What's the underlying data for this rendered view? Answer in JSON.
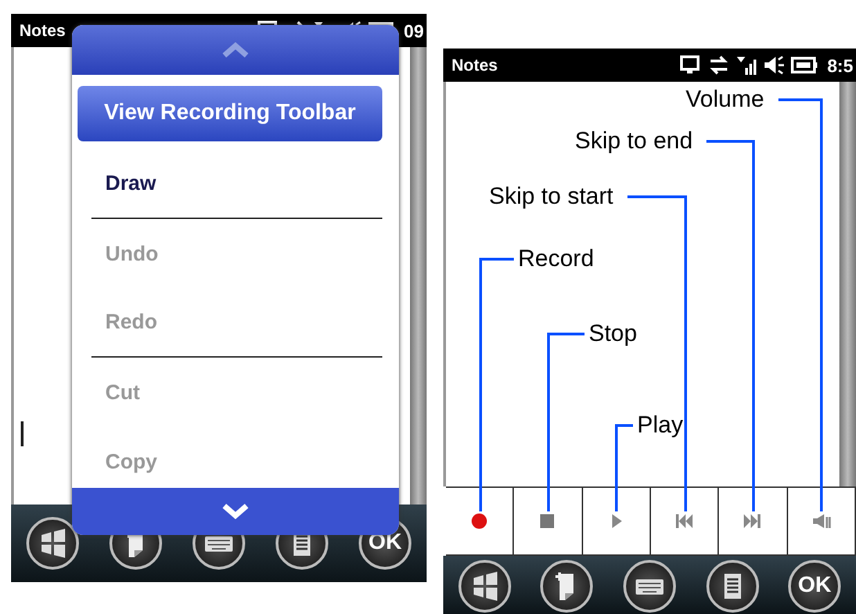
{
  "left_screen": {
    "status_bar": {
      "title": "Notes",
      "time": "09"
    },
    "menu": {
      "items": [
        {
          "label": "View Recording Toolbar",
          "selected": true,
          "disabled": false,
          "divider_after": false
        },
        {
          "label": "Draw",
          "selected": false,
          "disabled": false,
          "divider_after": true
        },
        {
          "label": "Undo",
          "selected": false,
          "disabled": true,
          "divider_after": false
        },
        {
          "label": "Redo",
          "selected": false,
          "disabled": true,
          "divider_after": true
        },
        {
          "label": "Cut",
          "selected": false,
          "disabled": true,
          "divider_after": false
        },
        {
          "label": "Copy",
          "selected": false,
          "disabled": true,
          "divider_after": false
        }
      ]
    },
    "softkeys": [
      {
        "kind": "start"
      },
      {
        "kind": "new"
      },
      {
        "kind": "keyboard"
      },
      {
        "kind": "menu"
      },
      {
        "kind": "ok",
        "label": "OK"
      }
    ]
  },
  "right_screen": {
    "status_bar": {
      "title": "Notes",
      "time": "8:5"
    },
    "toolbar": [
      {
        "kind": "record"
      },
      {
        "kind": "stop"
      },
      {
        "kind": "play"
      },
      {
        "kind": "skip-start"
      },
      {
        "kind": "skip-end"
      },
      {
        "kind": "volume"
      }
    ],
    "softkeys": [
      {
        "kind": "start"
      },
      {
        "kind": "new"
      },
      {
        "kind": "keyboard"
      },
      {
        "kind": "menu"
      },
      {
        "kind": "ok",
        "label": "OK"
      }
    ]
  },
  "callouts": [
    {
      "label": "Volume"
    },
    {
      "label": "Skip to end"
    },
    {
      "label": "Skip to start"
    },
    {
      "label": "Record"
    },
    {
      "label": "Stop"
    },
    {
      "label": "Play"
    }
  ]
}
